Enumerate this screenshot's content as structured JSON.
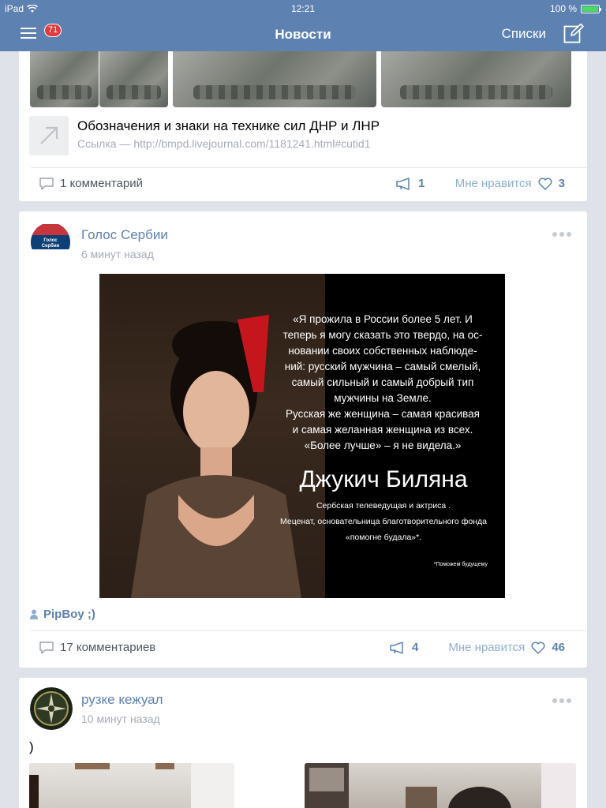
{
  "status": {
    "device": "iPad",
    "time": "12:21",
    "battery": "100 %",
    "battery_level": 1.0
  },
  "nav": {
    "title": "Новости",
    "lists_label": "Списки",
    "badge": "71"
  },
  "post1": {
    "link_title": "Обозначения и знаки на технике сил ДНР и ЛНР",
    "link_url": "Ссылка — http://bmpd.livejournal.com/1181241.html#cutid1",
    "comments": "1 комментарий",
    "shares": "1",
    "like_label": "Мне нравится",
    "likes": "3"
  },
  "post2": {
    "author": "Голос Сербии",
    "time": "6 минут назад",
    "avatar_text": "Голос Сербии",
    "image": {
      "quote_lines": [
        "«Я прожила в России более 5 лет. И",
        "теперь я могу сказать это твердо, на ос-",
        "новании своих собственных наблюде-",
        "ний: русский мужчина – самый смелый,",
        "самый сильный и самый добрый тип",
        "мужчины на Земле.",
        "Русская же женщина – самая красивая",
        "и самая желанная женщина из всех.",
        "«Более лучше» – я не видела.»"
      ],
      "name": "Джукич Биляна",
      "role_lines": [
        "Сербская телеведущая и актриса .",
        "Меценат, основательница благотворительного фонда",
        "«помогне будала»*."
      ],
      "footnote": "*Поможем будущему"
    },
    "reposter": "PipBoy ;)",
    "comments": "17 комментариев",
    "shares": "4",
    "like_label": "Мне нравится",
    "likes": "46"
  },
  "post3": {
    "author": "рузке кежуал",
    "time": "10 минут назад",
    "text": ")"
  },
  "colors": {
    "accent": "#5d81b1",
    "badge": "#e0393e",
    "background": "#dfe3e9"
  }
}
